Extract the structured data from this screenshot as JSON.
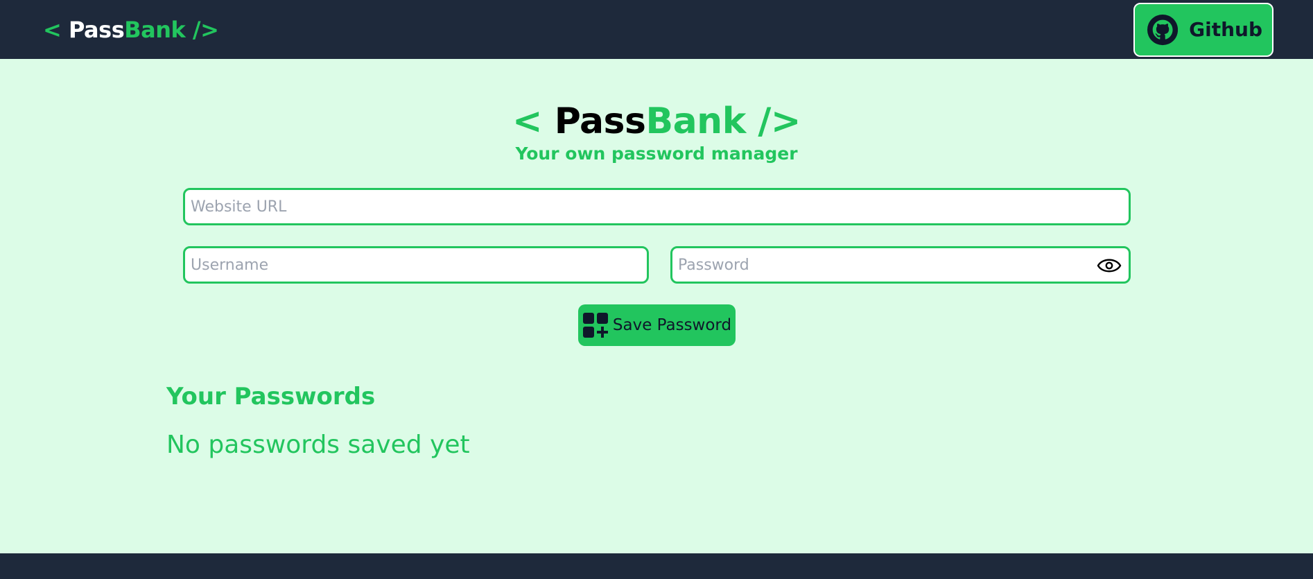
{
  "navbar": {
    "brand": {
      "open": "<",
      "pass": "Pass",
      "bank": "Bank",
      "close": "/>"
    },
    "github": {
      "label": "Github",
      "icon": "github-icon"
    }
  },
  "hero": {
    "brand": {
      "open": "<",
      "pass": "Pass",
      "bank": "Bank",
      "close": "/>"
    },
    "tagline": "Your own password manager"
  },
  "form": {
    "website": {
      "placeholder": "Website URL",
      "value": ""
    },
    "username": {
      "placeholder": "Username",
      "value": ""
    },
    "password": {
      "placeholder": "Password",
      "value": "",
      "toggle_icon": "eye-icon"
    },
    "save_label": "Save Password",
    "save_icon": "add-grid-icon"
  },
  "passwords": {
    "title": "Your Passwords",
    "empty_message": "No passwords saved yet",
    "items": []
  },
  "colors": {
    "accent": "#22c55e",
    "nav_bg": "#1e293b",
    "page_bg": "#dcfce7"
  }
}
